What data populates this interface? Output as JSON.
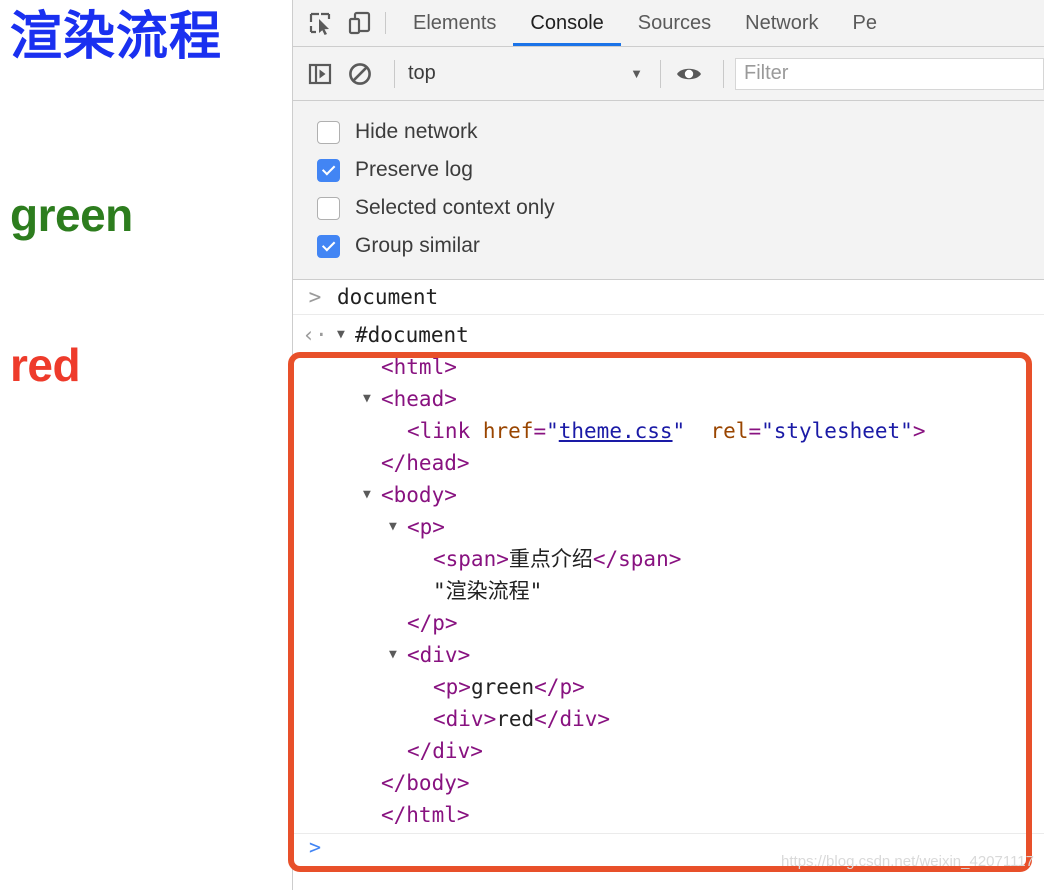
{
  "page": {
    "title": "渲染流程",
    "title_color": "#1a30f0",
    "green_text": "green",
    "green_color": "#2d7d1e",
    "red_text": "red",
    "red_color": "#ee3b2b"
  },
  "devtools": {
    "toolbar_icons": [
      {
        "name": "inspect-element-icon",
        "label": "Inspect element"
      },
      {
        "name": "device-toolbar-icon",
        "label": "Toggle device toolbar"
      }
    ],
    "tabs": [
      {
        "label": "Elements",
        "active": false
      },
      {
        "label": "Console",
        "active": true
      },
      {
        "label": "Sources",
        "active": false
      },
      {
        "label": "Network",
        "active": false
      },
      {
        "label": "Pe",
        "active": false
      }
    ],
    "active_tab_underline_color": "#1a73e8",
    "console_toolbar": {
      "sidebar_icon": "show-console-sidebar-icon",
      "clear_icon": "clear-console-icon",
      "context_value": "top",
      "caret": "▼",
      "eye_icon": "live-expression-eye-icon",
      "filter_placeholder": "Filter",
      "filter_value": ""
    },
    "options": [
      {
        "label": "Hide network",
        "checked": false
      },
      {
        "label": "Preserve log",
        "checked": true
      },
      {
        "label": "Selected context only",
        "checked": false
      },
      {
        "label": "Group similar",
        "checked": true
      }
    ],
    "checkbox_accent": "#4285f4",
    "messages": {
      "input_gutter": ">",
      "input_text": "document",
      "output_gutter": "‹·"
    },
    "dom_tree": [
      {
        "indent": 0,
        "twisty": "▼",
        "parts": [
          {
            "t": "hash",
            "v": "#document"
          }
        ]
      },
      {
        "indent": 1,
        "twisty": "",
        "parts": [
          {
            "t": "tag",
            "v": "<html>"
          }
        ]
      },
      {
        "indent": 1,
        "twisty": "▼",
        "parts": [
          {
            "t": "tag",
            "v": "<head>"
          }
        ]
      },
      {
        "indent": 2,
        "twisty": "",
        "parts": [
          {
            "t": "tag",
            "v": "<link "
          },
          {
            "t": "attr",
            "v": "href"
          },
          {
            "t": "tag",
            "v": "="
          },
          {
            "t": "val",
            "v": "\""
          },
          {
            "t": "link",
            "v": "theme.css"
          },
          {
            "t": "val",
            "v": "\""
          },
          {
            "t": "tag",
            "v": "  "
          },
          {
            "t": "attr",
            "v": "rel"
          },
          {
            "t": "tag",
            "v": "="
          },
          {
            "t": "val",
            "v": "\"stylesheet\""
          },
          {
            "t": "tag",
            "v": ">"
          }
        ]
      },
      {
        "indent": 1,
        "twisty": "",
        "parts": [
          {
            "t": "tag",
            "v": "</head>"
          }
        ]
      },
      {
        "indent": 1,
        "twisty": "▼",
        "parts": [
          {
            "t": "tag",
            "v": "<body>"
          }
        ]
      },
      {
        "indent": 2,
        "twisty": "▼",
        "parts": [
          {
            "t": "tag",
            "v": "<p>"
          }
        ]
      },
      {
        "indent": 3,
        "twisty": "",
        "parts": [
          {
            "t": "tag",
            "v": "<span>"
          },
          {
            "t": "text",
            "v": "重点介绍"
          },
          {
            "t": "tag",
            "v": "</span>"
          }
        ]
      },
      {
        "indent": 3,
        "twisty": "",
        "parts": [
          {
            "t": "text",
            "v": "\"渲染流程\""
          }
        ]
      },
      {
        "indent": 2,
        "twisty": "",
        "parts": [
          {
            "t": "tag",
            "v": "</p>"
          }
        ]
      },
      {
        "indent": 2,
        "twisty": "▼",
        "parts": [
          {
            "t": "tag",
            "v": "<div>"
          }
        ]
      },
      {
        "indent": 3,
        "twisty": "",
        "parts": [
          {
            "t": "tag",
            "v": "<p>"
          },
          {
            "t": "text",
            "v": "green"
          },
          {
            "t": "tag",
            "v": "</p>"
          }
        ]
      },
      {
        "indent": 3,
        "twisty": "",
        "parts": [
          {
            "t": "tag",
            "v": "<div>"
          },
          {
            "t": "text",
            "v": "red"
          },
          {
            "t": "tag",
            "v": "</div>"
          }
        ]
      },
      {
        "indent": 2,
        "twisty": "",
        "parts": [
          {
            "t": "tag",
            "v": "</div>"
          }
        ]
      },
      {
        "indent": 1,
        "twisty": "",
        "parts": [
          {
            "t": "tag",
            "v": "</body>"
          }
        ]
      },
      {
        "indent": 1,
        "twisty": "",
        "parts": [
          {
            "t": "tag",
            "v": "</html>"
          }
        ]
      }
    ],
    "next_prompt_caret": ">"
  },
  "annotation": {
    "box_color": "#e8502a"
  },
  "watermark": {
    "text": "https://blog.csdn.net/weixin_42071117"
  }
}
